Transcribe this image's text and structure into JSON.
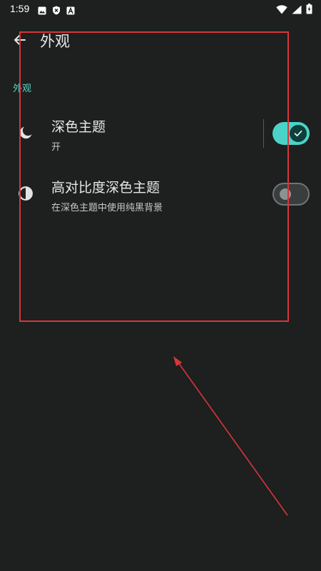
{
  "status_bar": {
    "time": "1:59",
    "icons": [
      "image-icon",
      "shield-icon",
      "font-a-icon",
      "wifi-icon",
      "signal-icon",
      "battery-icon"
    ]
  },
  "app_bar": {
    "title": "外观",
    "back_icon": "arrow-back-icon"
  },
  "section": {
    "title": "外观"
  },
  "settings": [
    {
      "title": "深色主题",
      "summary": "开",
      "icon": "moon-icon",
      "enabled": true
    },
    {
      "title": "高对比度深色主题",
      "summary": "在深色主题中使用纯黑背景",
      "icon": "contrast-icon",
      "enabled": false
    }
  ],
  "colors": {
    "background": "#1e1f1f",
    "accent": "#4ad3c7",
    "section_header": "#5fd3c6",
    "annotation": "#d8363b"
  }
}
